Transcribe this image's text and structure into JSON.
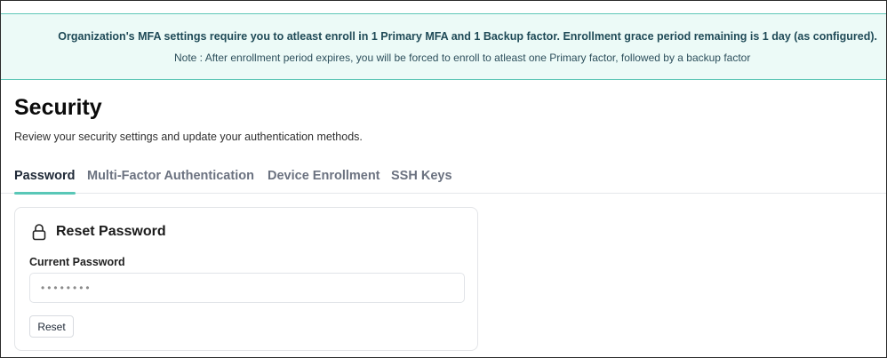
{
  "banner": {
    "message": "Organization's MFA settings require you to atleast enroll in 1 Primary MFA and 1 Backup factor. Enrollment grace period remaining is 1 day (as configured).",
    "note": "Note : After enrollment period expires, you will be forced to enroll to atleast one Primary factor, followed by a backup factor"
  },
  "page": {
    "title": "Security",
    "subtitle": "Review your security settings and update your authentication methods."
  },
  "tabs": [
    {
      "label": "Password",
      "active": true
    },
    {
      "label": "Multi-Factor Authentication",
      "active": false
    },
    {
      "label": "Device Enrollment",
      "active": false
    },
    {
      "label": "SSH Keys",
      "active": false
    }
  ],
  "reset_card": {
    "title": "Reset Password",
    "icon": "lock-icon",
    "current_password_label": "Current Password",
    "current_password_value": "••••••••",
    "reset_label": "Reset"
  },
  "colors": {
    "banner_bg": "#ecfaf7",
    "banner_border": "#5fc7b7",
    "accent": "#59c7b7"
  }
}
